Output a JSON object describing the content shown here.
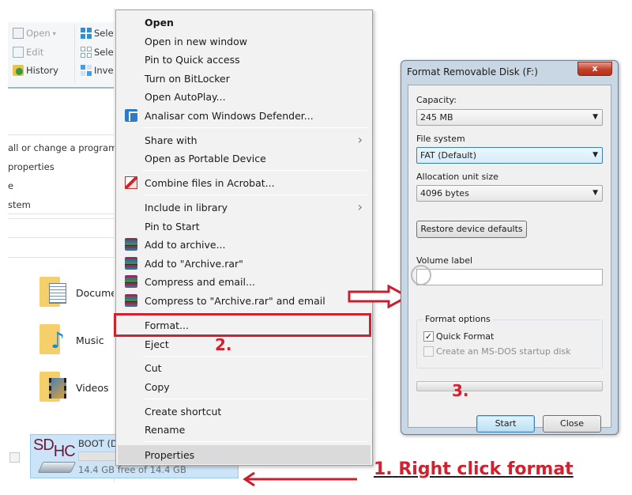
{
  "ribbon": {
    "items": [
      {
        "label": "Open",
        "icon": "open-icon",
        "has_dropdown": true,
        "disabled": true
      },
      {
        "label": "Edit",
        "icon": "edit-icon",
        "disabled": true
      },
      {
        "label": "History",
        "icon": "history-icon",
        "disabled": false
      },
      {
        "label": "Sele",
        "icon": "select-all-icon"
      },
      {
        "label": "Sele",
        "icon": "select-none-icon"
      },
      {
        "label": "Inve",
        "icon": "invert-selection-icon"
      }
    ]
  },
  "system_links": [
    "all or change a program",
    "properties",
    "e",
    "stem"
  ],
  "folders": [
    {
      "label": "Docume",
      "icon": "documents-folder-icon"
    },
    {
      "label": "Music",
      "icon": "music-folder-icon"
    },
    {
      "label": "Videos",
      "icon": "videos-folder-icon"
    }
  ],
  "drive": {
    "brand": "SD",
    "brand_sub": "HC",
    "name": "BOOT (D",
    "free_text": "14.4 GB free of 14.4 GB",
    "used_fraction": 0.0
  },
  "context_menu": {
    "items": [
      {
        "label": "Open",
        "bold": true
      },
      {
        "label": "Open in new window"
      },
      {
        "label": "Pin to Quick access"
      },
      {
        "label": "Turn on BitLocker"
      },
      {
        "label": "Open AutoPlay..."
      },
      {
        "label": "Analisar com Windows Defender...",
        "icon": "windows-defender-icon"
      },
      {
        "label": "Share with",
        "submenu": true
      },
      {
        "label": "Open as Portable Device"
      },
      {
        "label": "Combine files in Acrobat...",
        "icon": "acrobat-icon"
      },
      {
        "label": "Include in library",
        "submenu": true
      },
      {
        "label": "Pin to Start"
      },
      {
        "label": "Add to archive...",
        "icon": "winrar-icon"
      },
      {
        "label": "Add to \"Archive.rar\"",
        "icon": "winrar-icon"
      },
      {
        "label": "Compress and email...",
        "icon": "winrar-icon"
      },
      {
        "label": "Compress to \"Archive.rar\" and email",
        "icon": "winrar-icon"
      },
      {
        "label": "Format..."
      },
      {
        "label": "Eject"
      },
      {
        "label": "Cut"
      },
      {
        "label": "Copy"
      },
      {
        "label": "Create shortcut"
      },
      {
        "label": "Rename"
      },
      {
        "label": "Properties",
        "highlighted": true
      }
    ],
    "submenu_arrow": "›"
  },
  "annotations": {
    "step1_number": "1.",
    "step1_text": "Right click format",
    "step2": "2.",
    "step3": "3.",
    "accent_color": "#d1202e"
  },
  "format_dialog": {
    "title": "Format Removable Disk (F:)",
    "close_glyph": "x",
    "capacity_label": "Capacity:",
    "capacity_value": "245 MB",
    "filesystem_label": "File system",
    "filesystem_value": "FAT (Default)",
    "allocation_label": "Allocation unit size",
    "allocation_value": "4096 bytes",
    "restore_button": "Restore device defaults",
    "volume_label": "Volume label",
    "volume_value": "",
    "format_options_title": "Format options",
    "quick_format_label": "Quick Format",
    "quick_format_checked": true,
    "msdos_label": "Create an MS-DOS startup disk",
    "msdos_checked": false,
    "msdos_disabled": true,
    "progress": 0,
    "start_button": "Start",
    "close_button": "Close",
    "caret": "▼",
    "check_glyph": "✓"
  }
}
